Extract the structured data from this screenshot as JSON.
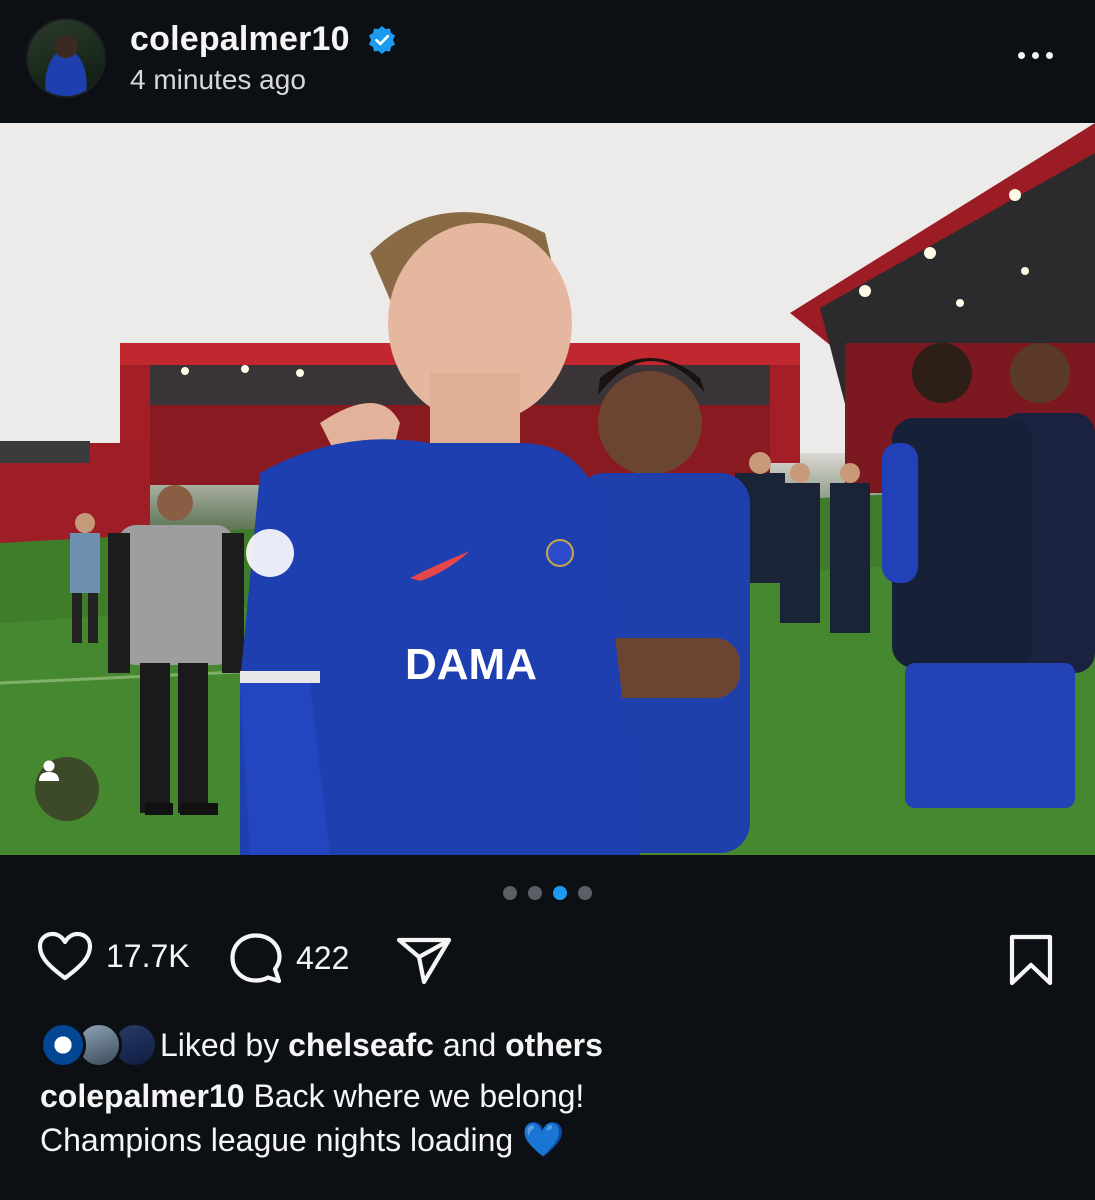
{
  "header": {
    "username": "colepalmer10",
    "timestamp": "4 minutes ago",
    "verified_icon": "verified-badge-icon",
    "more_icon": "more-options-icon",
    "verified_color": "#1d9bf0"
  },
  "post": {
    "image_alt_icon": "photo",
    "tag_icon": "user-tag-icon",
    "carousel": {
      "count": 4,
      "active_index": 2
    }
  },
  "actions": {
    "like_icon": "heart-icon",
    "like_count": "17.7K",
    "comment_icon": "comment-icon",
    "comment_count": "422",
    "share_icon": "send-icon",
    "save_icon": "bookmark-icon"
  },
  "liked_by": {
    "prefix": "Liked by",
    "user": "chelseafc",
    "joiner": "and",
    "others": "others"
  },
  "caption": {
    "username": "colepalmer10",
    "line1": "Back where we belong!",
    "line2": "Champions league nights loading",
    "emoji": "💙"
  },
  "colors": {
    "background": "#0c1014",
    "text": "#f5f5f5",
    "accent": "#1d9bf0",
    "jersey": "#1e3fae"
  }
}
